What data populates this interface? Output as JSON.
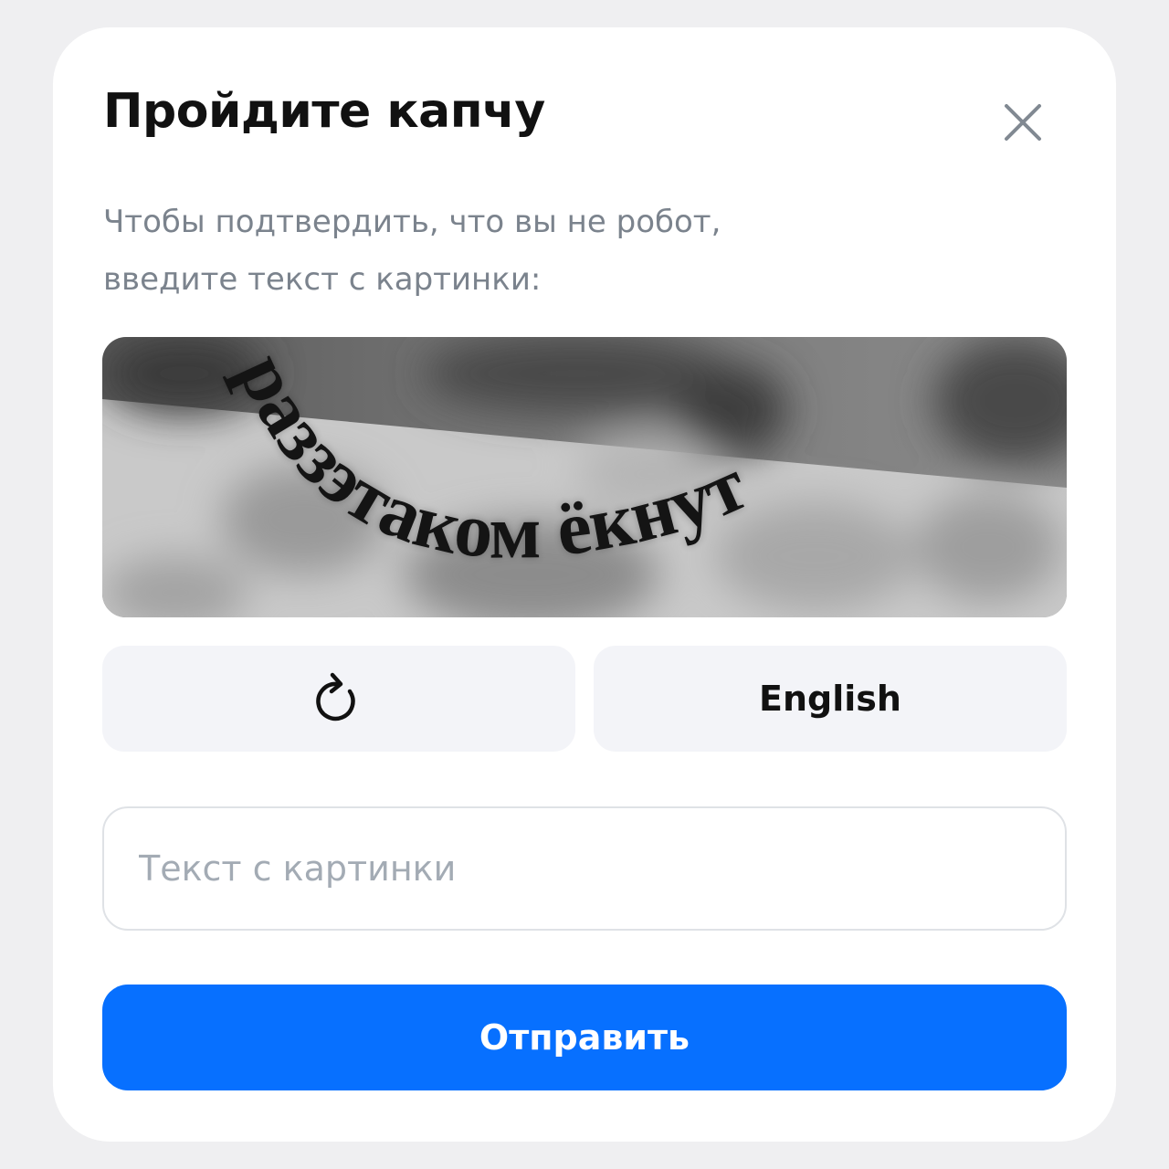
{
  "dialog": {
    "title": "Пройдите капчу",
    "subtitle_lines": [
      "Чтобы подтвердить, что вы не робот,",
      "введите текст с картинки:"
    ],
    "close_icon": "close-icon"
  },
  "captcha": {
    "text": "раззэтаком ёкнут"
  },
  "buttons": {
    "refresh_icon": "refresh-icon",
    "language_label": "English",
    "submit_label": "Отправить"
  },
  "input": {
    "value": "",
    "placeholder": "Текст с картинки"
  },
  "colors": {
    "accent": "#0770ff",
    "background": "#efeff1",
    "subtitle": "#7b838d",
    "placeholder": "#a3abb4",
    "secondary_button": "#f3f4f8"
  }
}
